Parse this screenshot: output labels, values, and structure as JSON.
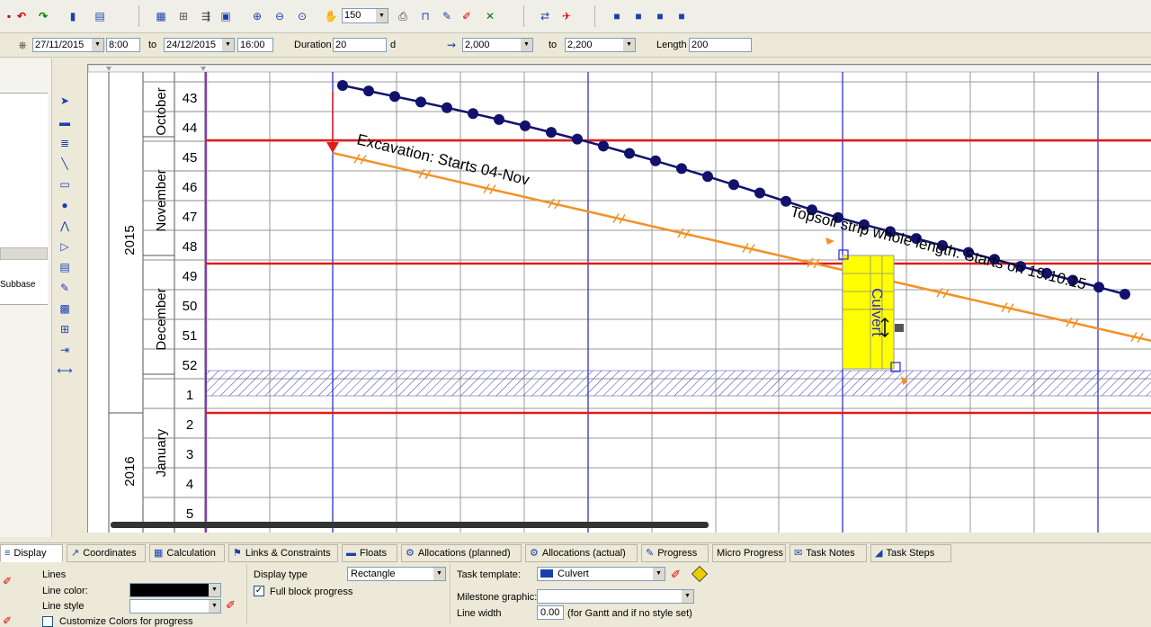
{
  "toolbar": {
    "zoom_value": "150"
  },
  "datebar": {
    "start_date": "27/11/2015",
    "start_time": "8:00",
    "to_label": "to",
    "end_date": "24/12/2015",
    "end_time": "16:00",
    "duration_label": "Duration",
    "duration_value": "20",
    "duration_unit": "d",
    "start_loc": "2,000",
    "to_label_2": "to",
    "end_loc": "2,200",
    "length_label": "Length",
    "length_value": "200"
  },
  "left_panel": {
    "item_text": "Subbase"
  },
  "timeline": {
    "years": [
      "2015",
      "2016"
    ],
    "months": [
      "October",
      "November",
      "December",
      "January"
    ],
    "weeks": [
      "43",
      "44",
      "45",
      "46",
      "47",
      "48",
      "49",
      "50",
      "51",
      "52",
      "1",
      "2",
      "3",
      "4",
      "5"
    ]
  },
  "tasks": {
    "excavation_label": "Excavation: Starts 04-Nov",
    "topsoil_label": "Topsoil strip whole length: Starts on 19.10.15",
    "culvert_label": "Culvert"
  },
  "colors": {
    "excavation_line": "#f29224",
    "topsoil_line": "#12126e",
    "culvert_fill": "#ffff00",
    "milestone_red": "#e21a1a",
    "grid_blue": "#2f2fd6"
  },
  "tabs": [
    {
      "label": "Display",
      "icon": "display-icon",
      "active": true
    },
    {
      "label": "Coordinates",
      "icon": "coordinates-icon",
      "active": false
    },
    {
      "label": "Calculation",
      "icon": "calculator-icon",
      "active": false
    },
    {
      "label": "Links & Constraints",
      "icon": "flag-icon",
      "active": false
    },
    {
      "label": "Floats",
      "icon": "floats-icon",
      "active": false
    },
    {
      "label": "Allocations (planned)",
      "icon": "allocations-planned-icon",
      "active": false
    },
    {
      "label": "Allocations (actual)",
      "icon": "allocations-actual-icon",
      "active": false
    },
    {
      "label": "Progress",
      "icon": "progress-icon",
      "active": false
    },
    {
      "label": "Micro Progress",
      "icon": "",
      "active": false
    },
    {
      "label": "Task Notes",
      "icon": "task-notes-icon",
      "active": false
    },
    {
      "label": "Task Steps",
      "icon": "task-steps-icon",
      "active": false
    }
  ],
  "props": {
    "lines_label": "Lines",
    "line_color_label": "Line color:",
    "line_style_label": "Line style",
    "customize_colors_label": "Customize Colors for progress",
    "display_type_label": "Display type",
    "display_type_value": "Rectangle",
    "full_block_progress_label": "Full block progress",
    "full_block_progress_checked": true,
    "task_template_label": "Task template:",
    "task_template_value": "Culvert",
    "milestone_graphic_label": "Milestone graphic:",
    "milestone_graphic_value": "",
    "line_width_label": "Line width",
    "line_width_value": "0.00",
    "line_width_note": "(for Gantt and if no style set)"
  }
}
